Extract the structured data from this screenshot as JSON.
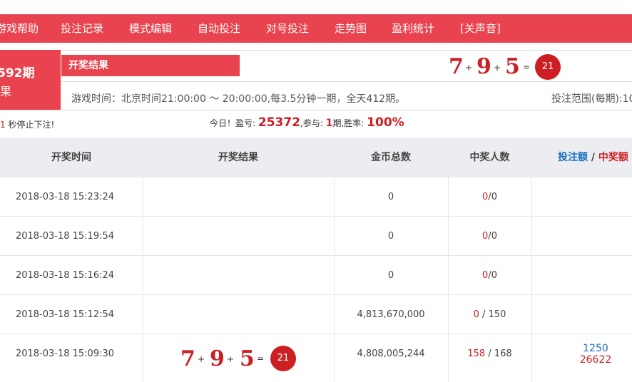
{
  "nav": {
    "items": [
      {
        "label": "游戏帮助"
      },
      {
        "label": "投注记录"
      },
      {
        "label": "模式编辑"
      },
      {
        "label": "自动投注"
      },
      {
        "label": "对号投注"
      },
      {
        "label": "走势图"
      },
      {
        "label": "盈利统计"
      },
      {
        "label": "[关声音]"
      }
    ]
  },
  "current": {
    "period_number": "592期",
    "period_sub": "果",
    "tab_label": "开奖结果",
    "digits": [
      "7",
      "9",
      "5"
    ],
    "plus": "+",
    "equals": "=",
    "sum": "21",
    "game_time": "游戏时间：北京时间21:00:00 ～ 20:00:00,每3.5分钟一期，全天412期。",
    "bet_range": "投注范围(每期):10"
  },
  "countdown": {
    "seconds": "1",
    "text": "秒停止下注!"
  },
  "today": {
    "label": "今日！盈亏:",
    "profit": "25372",
    "join_label": ",参与:",
    "periods": "1",
    "periods_unit": "期",
    "rate_label": ",胜率:",
    "rate": "100%"
  },
  "table": {
    "headers": {
      "time": "开奖时间",
      "result": "开奖结果",
      "coins": "金币总数",
      "winners": "中奖人数",
      "bet": "投注额",
      "sep": "/",
      "win": "中奖额"
    },
    "rows": [
      {
        "time": "2018-03-18 15:23:24",
        "coins": "0",
        "win_count": "0",
        "sep": "/",
        "total": "0"
      },
      {
        "time": "2018-03-18 15:19:54",
        "coins": "0",
        "win_count": "0",
        "sep": "/",
        "total": "0"
      },
      {
        "time": "2018-03-18 15:16:24",
        "coins": "0",
        "win_count": "0",
        "sep": "/",
        "total": "0"
      },
      {
        "time": "2018-03-18 15:12:54",
        "coins": "4,813,670,000",
        "win_count": "0",
        "sep": "/",
        "total": "150"
      },
      {
        "time": "2018-03-18 15:09:30",
        "coins": "4,808,005,244",
        "win_count": "158",
        "sep": "/",
        "total": "168",
        "result": {
          "digits": [
            "7",
            "9",
            "5"
          ],
          "plus": "+",
          "equals": "=",
          "sum": "21"
        },
        "bet_amount": "1250",
        "win_amount": "26622"
      }
    ]
  },
  "colors": {
    "brand_red": "#e8434e",
    "number_red": "#cc1f24",
    "link_blue": "#1a6fc0",
    "header_gray": "#ebedf0"
  }
}
